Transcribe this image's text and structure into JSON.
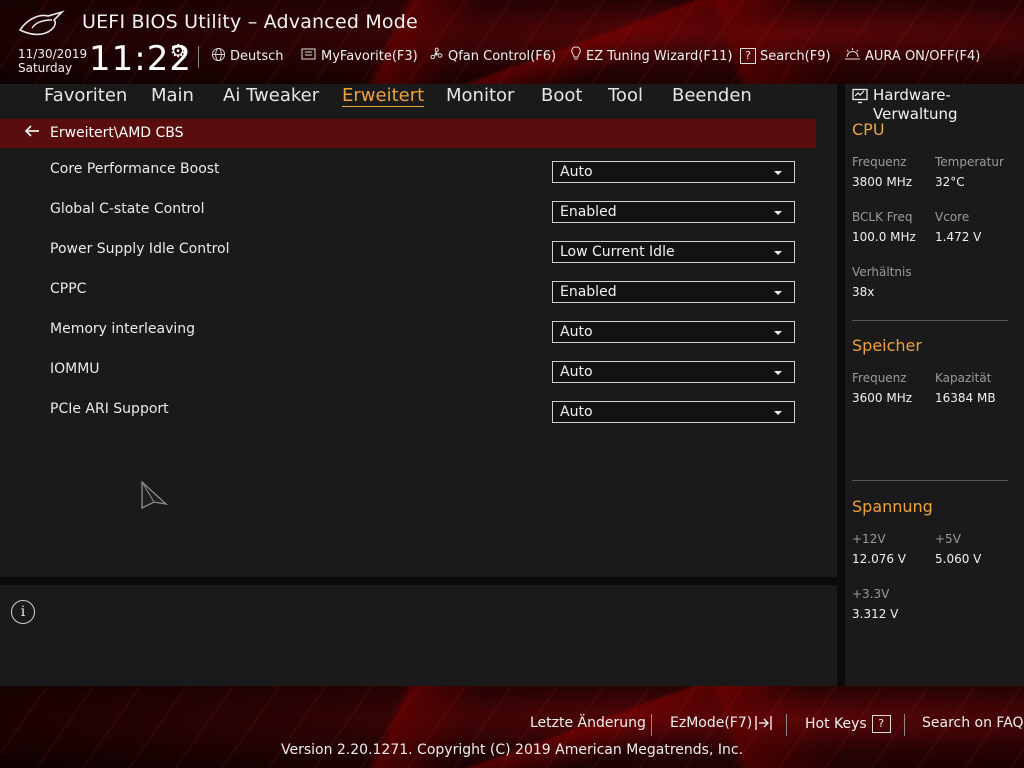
{
  "header": {
    "title": "UEFI BIOS Utility – Advanced Mode",
    "date": "11/30/2019",
    "day": "Saturday",
    "time": "11:22",
    "toolbar": [
      {
        "icon": "globe-icon",
        "label": "Deutsch"
      },
      {
        "icon": "favorite-icon",
        "label": "MyFavorite(F3)"
      },
      {
        "icon": "fan-icon",
        "label": "Qfan Control(F6)"
      },
      {
        "icon": "lightbulb-icon",
        "label": "EZ Tuning Wizard(F11)"
      },
      {
        "icon": "help-box-icon",
        "label": "Search(F9)"
      },
      {
        "icon": "aura-icon",
        "label": "AURA ON/OFF(F4)"
      }
    ]
  },
  "tabs": [
    {
      "label": "Favoriten",
      "active": false
    },
    {
      "label": "Main",
      "active": false
    },
    {
      "label": "Ai Tweaker",
      "active": false
    },
    {
      "label": "Erweitert",
      "active": true
    },
    {
      "label": "Monitor",
      "active": false
    },
    {
      "label": "Boot",
      "active": false
    },
    {
      "label": "Tool",
      "active": false
    },
    {
      "label": "Beenden",
      "active": false
    }
  ],
  "breadcrumb": "Erweitert\\AMD CBS",
  "settings": [
    {
      "label": "Core Performance Boost",
      "value": "Auto"
    },
    {
      "label": "Global C-state Control",
      "value": "Enabled"
    },
    {
      "label": "Power Supply Idle Control",
      "value": "Low Current Idle"
    },
    {
      "label": "CPPC",
      "value": "Enabled"
    },
    {
      "label": "Memory interleaving",
      "value": "Auto"
    },
    {
      "label": "IOMMU",
      "value": "Auto"
    },
    {
      "label": "PCIe ARI Support",
      "value": "Auto"
    }
  ],
  "hardware": {
    "title": "Hardware-Verwaltung",
    "cpu": {
      "heading": "CPU",
      "freq_label": "Frequenz",
      "freq": "3800 MHz",
      "temp_label": "Temperatur",
      "temp": "32°C",
      "bclk_label": "BCLK Freq",
      "bclk": "100.0 MHz",
      "vcore_label": "Vcore",
      "vcore": "1.472 V",
      "ratio_label": "Verhältnis",
      "ratio": "38x"
    },
    "memory": {
      "heading": "Speicher",
      "freq_label": "Frequenz",
      "freq": "3600 MHz",
      "cap_label": "Kapazität",
      "cap": "16384 MB"
    },
    "voltage": {
      "heading": "Spannung",
      "v12_label": "+12V",
      "v12": "12.076 V",
      "v5_label": "+5V",
      "v5": "5.060 V",
      "v33_label": "+3.3V",
      "v33": "3.312 V"
    }
  },
  "footer": {
    "last_change": "Letzte Änderung",
    "ezmode": "EzMode(F7)",
    "hotkeys": "Hot Keys",
    "faq": "Search on FAQ",
    "copyright": "Version 2.20.1271. Copyright (C) 2019 American Megatrends, Inc."
  },
  "colors": {
    "accent": "#f0a23a",
    "breadcrumb_bg": "#5a0d0d",
    "panel_bg": "#1a1a1a"
  }
}
